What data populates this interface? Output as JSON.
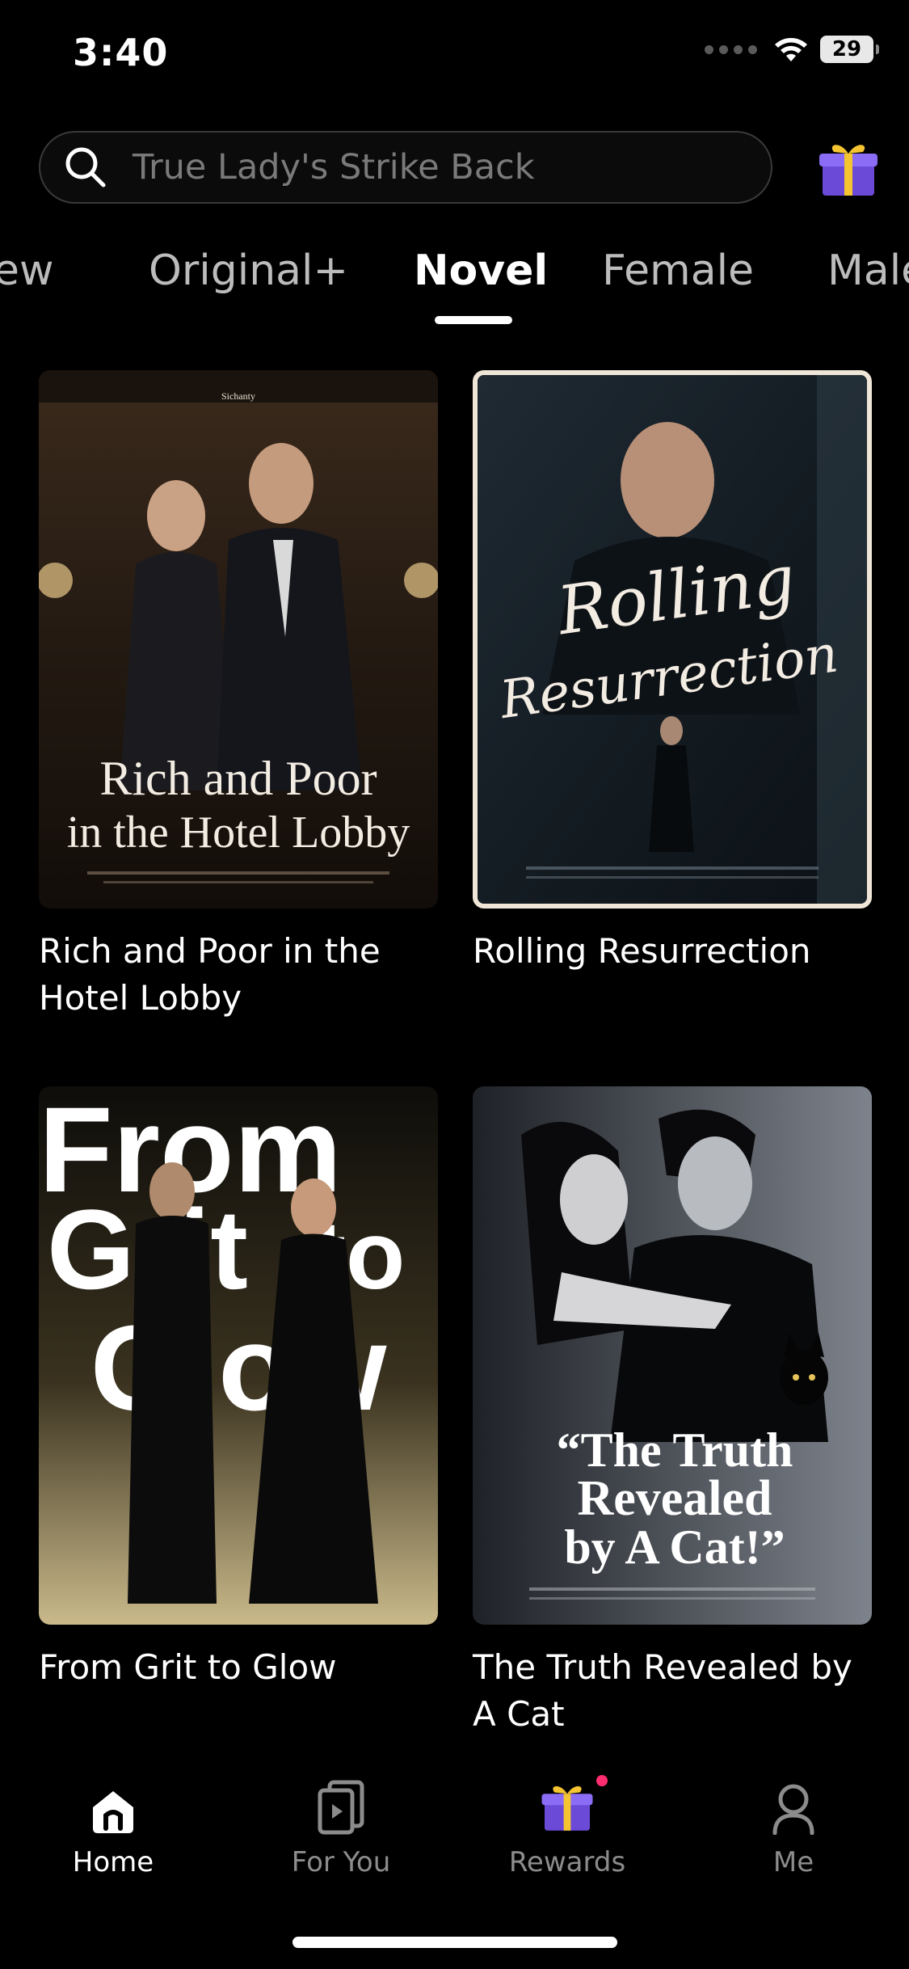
{
  "status_bar": {
    "time": "3:40",
    "battery": "29"
  },
  "search": {
    "placeholder": "True Lady's Strike Back"
  },
  "tabs": [
    {
      "label": "ew",
      "active": false
    },
    {
      "label": "Original+",
      "active": false
    },
    {
      "label": "Novel",
      "active": true
    },
    {
      "label": "Female",
      "active": false
    },
    {
      "label": "Male",
      "active": false
    }
  ],
  "books": [
    {
      "title": "Rich and Poor in the Hotel Lobby",
      "cover_text": [
        "Rich and Poor",
        "in the Hotel Lobby"
      ],
      "cover_small": "Sichanty"
    },
    {
      "title": "Rolling Resurrection",
      "cover_text": [
        "Rolling",
        "Resurrection"
      ]
    },
    {
      "title": "From Grit to Glow",
      "cover_text": [
        "From",
        "Grit",
        "to",
        "Glow"
      ]
    },
    {
      "title": "The Truth Revealed by A Cat",
      "cover_text": [
        "“The Truth",
        "Revealed",
        "by A Cat!”"
      ]
    }
  ],
  "bottom_nav": [
    {
      "label": "Home",
      "icon": "home-icon",
      "active": true
    },
    {
      "label": "For You",
      "icon": "for-you-icon",
      "active": false
    },
    {
      "label": "Rewards",
      "icon": "gift-icon",
      "active": false
    },
    {
      "label": "Me",
      "icon": "person-icon",
      "active": false
    }
  ],
  "colors": {
    "background": "#000000",
    "accent_badge": "#ff2d6f",
    "gift_purple": "#7b5cf0",
    "gift_ribbon": "#f5c431"
  }
}
